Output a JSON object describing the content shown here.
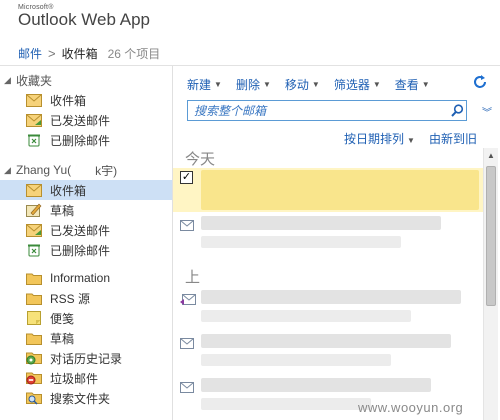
{
  "app": {
    "brand_small": "Microsoft®",
    "brand_name": "Outlook Web App"
  },
  "breadcrumb": {
    "root": "邮件",
    "separator": ">",
    "current": "收件箱",
    "count": "26 个项目"
  },
  "favorites": {
    "title": "收藏夹",
    "items": [
      {
        "label": "收件箱",
        "icon": "inbox-icon"
      },
      {
        "label": "已发送邮件",
        "icon": "sent-icon"
      },
      {
        "label": "已删除邮件",
        "icon": "deleted-icon"
      }
    ]
  },
  "mailbox": {
    "owner_left": "Zhang Yu(",
    "owner_right": "k宇)",
    "items": [
      {
        "label": "收件箱",
        "icon": "inbox-icon",
        "selected": true
      },
      {
        "label": "草稿",
        "icon": "drafts-icon"
      },
      {
        "label": "已发送邮件",
        "icon": "sent-icon"
      },
      {
        "label": "已删除邮件",
        "icon": "deleted-icon"
      }
    ],
    "folders": [
      {
        "label": "Information",
        "icon": "folder-icon"
      },
      {
        "label": "RSS 源",
        "icon": "folder-icon"
      },
      {
        "label": "便笺",
        "icon": "notes-icon"
      },
      {
        "label": "草稿",
        "icon": "folder-icon"
      },
      {
        "label": "对话历史记录",
        "icon": "conversation-icon"
      },
      {
        "label": "垃圾邮件",
        "icon": "junk-icon"
      },
      {
        "label": "搜索文件夹",
        "icon": "search-folder-icon"
      }
    ]
  },
  "toolbar": {
    "new": "新建",
    "delete": "删除",
    "move": "移动",
    "filter": "筛选器",
    "view": "查看"
  },
  "search": {
    "placeholder": "搜索整个邮箱"
  },
  "sort": {
    "by": "按日期排列",
    "order": "由新到旧"
  },
  "groups": {
    "today": "今天",
    "earlier": "上"
  },
  "watermark": "www.wooyun.org",
  "colors": {
    "accent": "#1e5fb3",
    "selected_row": "#fff5c4",
    "nav_selected": "#cde0f5"
  }
}
